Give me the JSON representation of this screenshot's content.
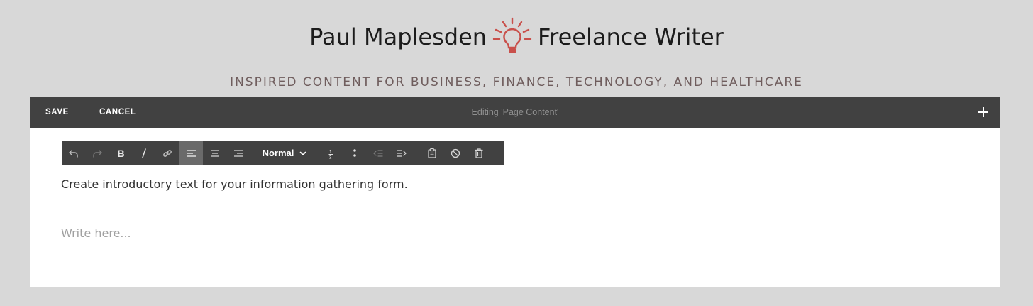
{
  "site": {
    "title_left": "Paul Maplesden",
    "title_right": "Freelance Writer",
    "logo_icon": "lightbulb-icon",
    "tagline": "INSPIRED CONTENT FOR BUSINESS, FINANCE, TECHNOLOGY, AND HEALTHCARE",
    "accent_color": "#c9504b"
  },
  "editor_bar": {
    "save_label": "SAVE",
    "cancel_label": "CANCEL",
    "editing_label": "Editing 'Page Content'",
    "add_icon": "plus-icon"
  },
  "toolbar": {
    "groups": [
      [
        "undo-icon",
        "redo-icon",
        "bold-icon",
        "italic-icon",
        "link-icon"
      ],
      [
        "align-left-icon",
        "align-center-icon",
        "align-right-icon"
      ],
      [
        "format-select"
      ],
      [
        "ordered-list-icon",
        "unordered-list-icon",
        "outdent-icon",
        "indent-icon",
        "paste-icon",
        "clear-format-icon",
        "delete-icon"
      ]
    ],
    "active": "align-left-icon",
    "format_value": "Normal"
  },
  "content": {
    "intro_text": "Create introductory text for your information gathering form.",
    "write_placeholder": "Write here..."
  }
}
